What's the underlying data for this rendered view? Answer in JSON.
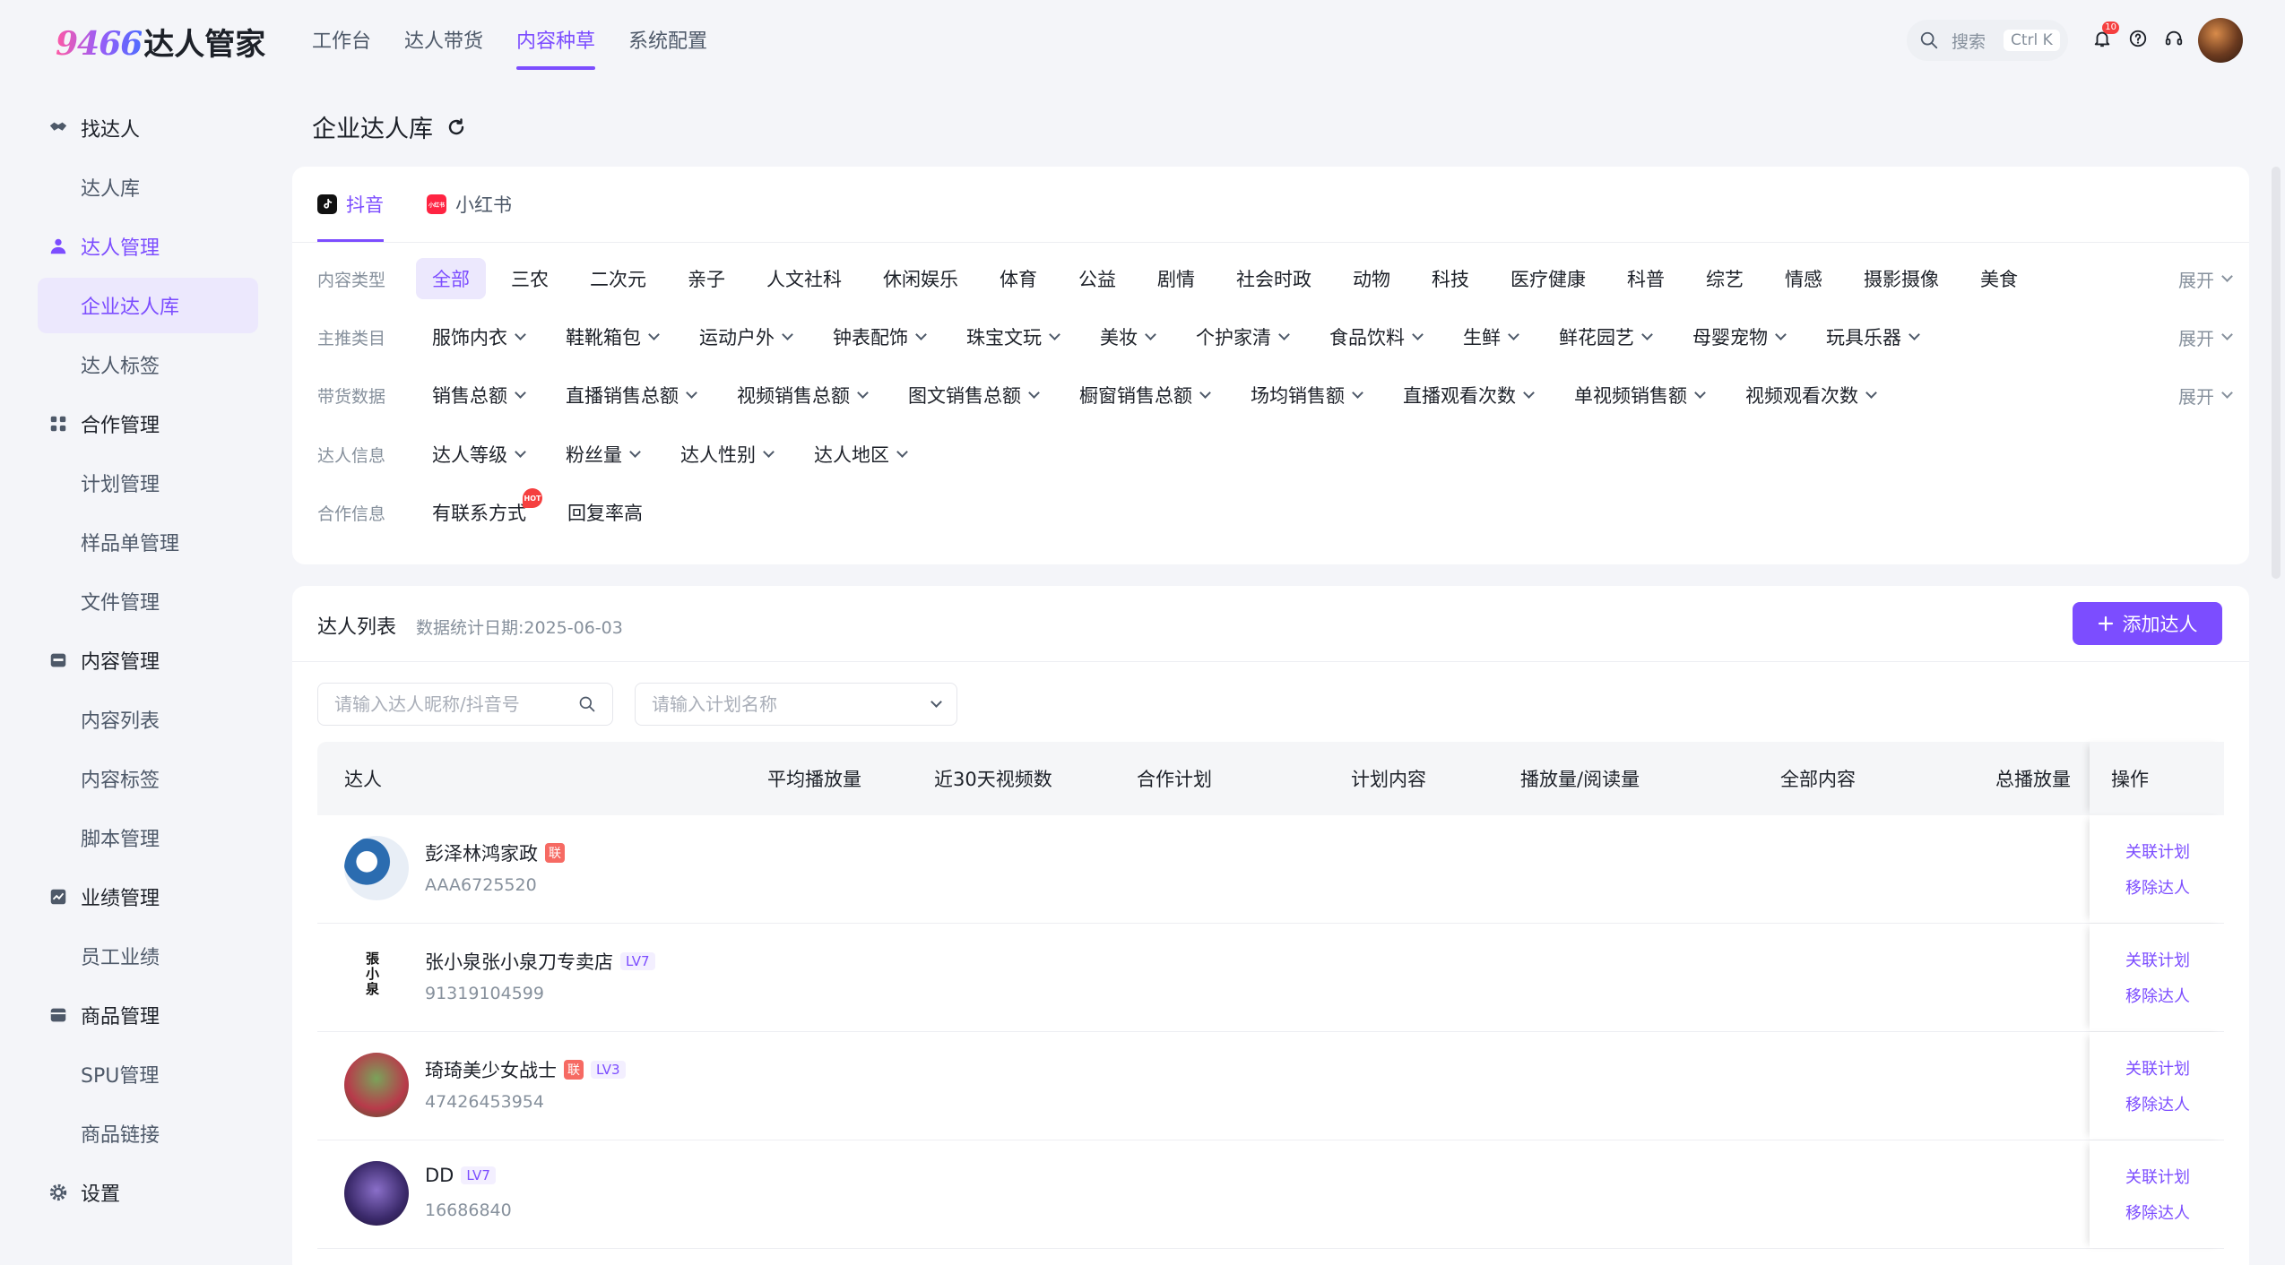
{
  "app": {
    "logo_num": "9466",
    "logo_text": "达人管家"
  },
  "topnav": [
    "工作台",
    "达人带货",
    "内容种草",
    "系统配置"
  ],
  "topnav_active": 2,
  "search": {
    "label": "搜索",
    "shortcut": "Ctrl K"
  },
  "notifications": {
    "count": "10"
  },
  "sidebar": [
    {
      "type": "group",
      "label": "找达人",
      "icon": "handshake-icon"
    },
    {
      "type": "item",
      "label": "达人库"
    },
    {
      "type": "group",
      "label": "达人管理",
      "icon": "user-icon",
      "active": true
    },
    {
      "type": "item",
      "label": "企业达人库",
      "active": true
    },
    {
      "type": "item",
      "label": "达人标签"
    },
    {
      "type": "group",
      "label": "合作管理",
      "icon": "grid-icon"
    },
    {
      "type": "item",
      "label": "计划管理"
    },
    {
      "type": "item",
      "label": "样品单管理"
    },
    {
      "type": "item",
      "label": "文件管理"
    },
    {
      "type": "group",
      "label": "内容管理",
      "icon": "inbox-icon"
    },
    {
      "type": "item",
      "label": "内容列表"
    },
    {
      "type": "item",
      "label": "内容标签"
    },
    {
      "type": "item",
      "label": "脚本管理"
    },
    {
      "type": "group",
      "label": "业绩管理",
      "icon": "chart-icon"
    },
    {
      "type": "item",
      "label": "员工业绩"
    },
    {
      "type": "group",
      "label": "商品管理",
      "icon": "box-icon"
    },
    {
      "type": "item",
      "label": "SPU管理"
    },
    {
      "type": "item",
      "label": "商品链接"
    },
    {
      "type": "group",
      "label": "设置",
      "icon": "gear-icon"
    }
  ],
  "page": {
    "title": "企业达人库"
  },
  "platforms": [
    {
      "label": "抖音",
      "icon": "douyin-icon",
      "active": true
    },
    {
      "label": "小红书",
      "icon": "xiaohongshu-icon",
      "icon_text": "小红书"
    }
  ],
  "filters": {
    "expand_label": "展开",
    "content_type": {
      "label": "内容类型",
      "options": [
        "全部",
        "三农",
        "二次元",
        "亲子",
        "人文社科",
        "休闲娱乐",
        "体育",
        "公益",
        "剧情",
        "社会时政",
        "动物",
        "科技",
        "医疗健康",
        "科普",
        "综艺",
        "情感",
        "摄影摄像",
        "美食"
      ],
      "selected": 0
    },
    "category": {
      "label": "主推类目",
      "options": [
        "服饰内衣",
        "鞋靴箱包",
        "运动户外",
        "钟表配饰",
        "珠宝文玩",
        "美妆",
        "个护家清",
        "食品饮料",
        "生鲜",
        "鲜花园艺",
        "母婴宠物",
        "玩具乐器"
      ]
    },
    "sales": {
      "label": "带货数据",
      "options": [
        "销售总额",
        "直播销售总额",
        "视频销售总额",
        "图文销售总额",
        "橱窗销售总额",
        "场均销售额",
        "直播观看次数",
        "单视频销售额",
        "视频观看次数"
      ]
    },
    "info": {
      "label": "达人信息",
      "options": [
        "达人等级",
        "粉丝量",
        "达人性别",
        "达人地区"
      ]
    },
    "coop": {
      "label": "合作信息",
      "options": [
        "有联系方式",
        "回复率高"
      ],
      "hot_badge": "HOT"
    }
  },
  "list": {
    "title": "达人列表",
    "stat_date": "数据统计日期:2025-06-03",
    "add_button": "添加达人",
    "search_placeholder": "请输入达人昵称/抖音号",
    "plan_placeholder": "请输入计划名称",
    "columns": [
      "达人",
      "平均播放量",
      "近30天视频数",
      "合作计划",
      "计划内容",
      "播放量/阅读量",
      "全部内容",
      "总播放量",
      "操作"
    ],
    "op_link": "关联计划",
    "op_remove": "移除达人",
    "rows": [
      {
        "name": "彭泽林鸿家政",
        "id": "AAA6725520",
        "lian": "联",
        "lv": ""
      },
      {
        "name": "张小泉张小泉刀专卖店",
        "id": "91319104599",
        "lian": "",
        "lv": "LV7"
      },
      {
        "name": "琦琦美少女战士",
        "id": "47426453954",
        "lian": "联",
        "lv": "LV3"
      },
      {
        "name": "DD",
        "id": "16686840",
        "lian": "",
        "lv": "LV7"
      }
    ]
  },
  "colors": {
    "accent": "#7c4dff",
    "accent_light": "#ece8fd",
    "tag_red": "#f66a63"
  }
}
